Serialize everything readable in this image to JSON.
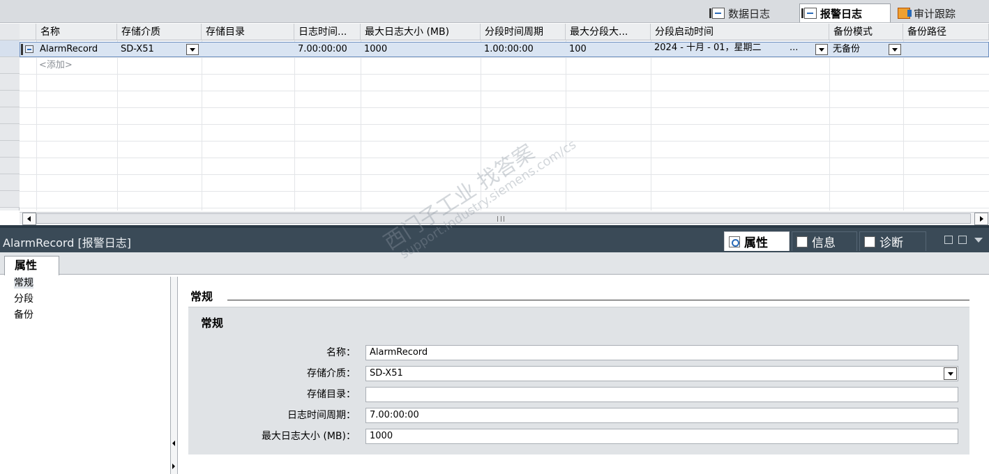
{
  "top_tabs": [
    {
      "label": "数据日志",
      "icon": "log-icon",
      "active": false
    },
    {
      "label": "报警日志",
      "icon": "log-icon",
      "active": true
    },
    {
      "label": "审计跟踪",
      "icon": "audit-icon",
      "active": false
    }
  ],
  "table": {
    "columns": [
      "名称",
      "存储介质",
      "存储目录",
      "日志时间...",
      "最大日志大小 (MB)",
      "分段时间周期",
      "最大分段大...",
      "分段启动时间",
      "备份模式",
      "备份路径"
    ],
    "rows": [
      {
        "name": "AlarmRecord",
        "storage_medium": "SD-X51",
        "storage_dir": "",
        "log_time_period": "7.00:00:00",
        "max_log_size": "1000",
        "segment_time_period": "1.00:00:00",
        "max_segment_size": "100",
        "segment_start_time": "2024 - 十月  - 01，星期二",
        "segment_start_ellipsis": "...",
        "backup_mode": "无备份",
        "backup_path": ""
      }
    ],
    "add_row_label": "<添加>"
  },
  "inspector": {
    "title": "AlarmRecord [报警日志]",
    "tabs": [
      {
        "label": "属性",
        "icon": "properties-icon",
        "active": true
      },
      {
        "label": "信息",
        "icon": "info-icon",
        "active": false
      },
      {
        "label": "诊断",
        "icon": "diagnostics-icon",
        "active": false
      }
    ]
  },
  "properties": {
    "tab_label": "属性",
    "nav_items": [
      "常规",
      "分段",
      "备份"
    ],
    "section_header": "常规",
    "panel_title": "常规",
    "fields": [
      {
        "label": "名称：",
        "value": "AlarmRecord",
        "dropdown": false
      },
      {
        "label": "存储介质：",
        "value": "SD-X51",
        "dropdown": true
      },
      {
        "label": "存储目录：",
        "value": "",
        "dropdown": false
      },
      {
        "label": "日志时间周期：",
        "value": "7.00:00:00",
        "dropdown": false
      },
      {
        "label": "最大日志大小 (MB)：",
        "value": "1000",
        "dropdown": false
      }
    ]
  },
  "watermark": {
    "line1": "西门子工业 找答案",
    "line2": "support.industry.siemens.com/cs"
  },
  "colors": {
    "selection": "#d9e4f2",
    "inspector_bar": "#3a4a57",
    "panel": "#e0e3e6"
  }
}
